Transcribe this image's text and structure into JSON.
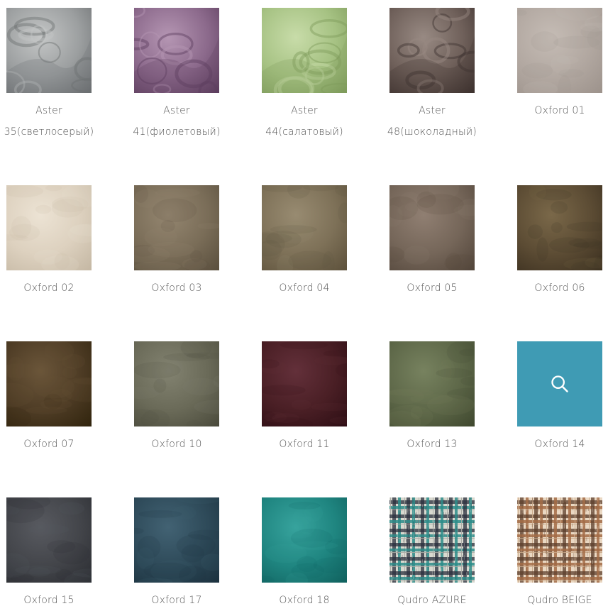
{
  "swatches": [
    {
      "id": "aster-35",
      "lines": [
        "Aster",
        "35(светлосерый)"
      ],
      "color": "#9c9fa0",
      "light": "#c4c6c6",
      "dark": "#6d7072",
      "pattern": "damask"
    },
    {
      "id": "aster-41",
      "lines": [
        "Aster",
        "41(фиолетовый)"
      ],
      "color": "#8c6a8c",
      "light": "#b596b3",
      "dark": "#5e3f5f",
      "pattern": "damask"
    },
    {
      "id": "aster-44",
      "lines": [
        "Aster",
        "44(салатовый)"
      ],
      "color": "#a6c283",
      "light": "#c8dca9",
      "dark": "#7f9c5c",
      "pattern": "damask"
    },
    {
      "id": "aster-48",
      "lines": [
        "Aster",
        "48(шоколадный)"
      ],
      "color": "#6f605a",
      "light": "#988a83",
      "dark": "#3f3330",
      "pattern": "damask"
    },
    {
      "id": "oxford-01",
      "lines": [
        "Oxford 01"
      ],
      "color": "#b2a8a1",
      "light": "#c5bcb5",
      "dark": "#9e948d",
      "pattern": "velvet"
    },
    {
      "id": "oxford-02",
      "lines": [
        "Oxford 02"
      ],
      "color": "#ddd1bf",
      "light": "#ece3d4",
      "dark": "#c6b9a5",
      "pattern": "velvet"
    },
    {
      "id": "oxford-03",
      "lines": [
        "Oxford 03"
      ],
      "color": "#7a6d58",
      "light": "#948670",
      "dark": "#5c513f",
      "pattern": "velvet"
    },
    {
      "id": "oxford-04",
      "lines": [
        "Oxford 04"
      ],
      "color": "#7e7158",
      "light": "#988b71",
      "dark": "#5f533d",
      "pattern": "velvet"
    },
    {
      "id": "oxford-05",
      "lines": [
        "Oxford 05"
      ],
      "color": "#756659",
      "light": "#907f72",
      "dark": "#54473c",
      "pattern": "velvet"
    },
    {
      "id": "oxford-06",
      "lines": [
        "Oxford 06"
      ],
      "color": "#5c4c34",
      "light": "#7a6849",
      "dark": "#3c3020",
      "pattern": "velvet"
    },
    {
      "id": "oxford-07",
      "lines": [
        "Oxford 07"
      ],
      "color": "#4e3c25",
      "light": "#6b563a",
      "dark": "#33260f",
      "pattern": "velvet"
    },
    {
      "id": "oxford-10",
      "lines": [
        "Oxford 10"
      ],
      "color": "#6a6a58",
      "light": "#838371",
      "dark": "#4c4c3d",
      "pattern": "velvet"
    },
    {
      "id": "oxford-11",
      "lines": [
        "Oxford 11"
      ],
      "color": "#4a1f25",
      "light": "#63303a",
      "dark": "#2f0f15",
      "pattern": "velvet"
    },
    {
      "id": "oxford-13",
      "lines": [
        "Oxford 13"
      ],
      "color": "#5d6748",
      "light": "#77825f",
      "dark": "#414a30",
      "pattern": "velvet"
    },
    {
      "id": "oxford-14",
      "lines": [
        "Oxford 14"
      ],
      "color": "#3f9bb4",
      "light": "#4ea8c0",
      "dark": "#3790a8",
      "pattern": "hover",
      "overlay_icon": "search-icon"
    },
    {
      "id": "oxford-15",
      "lines": [
        "Oxford 15"
      ],
      "color": "#43454a",
      "light": "#585a60",
      "dark": "#2c2e33",
      "pattern": "velvet"
    },
    {
      "id": "oxford-17",
      "lines": [
        "Oxford 17"
      ],
      "color": "#2e4a59",
      "light": "#426273",
      "dark": "#1d3340",
      "pattern": "velvet"
    },
    {
      "id": "oxford-18",
      "lines": [
        "Oxford 18"
      ],
      "color": "#1f8580",
      "light": "#37a39d",
      "dark": "#116360",
      "pattern": "velvet"
    },
    {
      "id": "qudro-azure",
      "lines": [
        "Qudro AZURE"
      ],
      "color": "#a9aaa4",
      "light": "#d9d9d0",
      "dark": "#2a2f3d",
      "accent": "#2d8c8a",
      "pattern": "plaid"
    },
    {
      "id": "qudro-beige",
      "lines": [
        "Qudro BEIGE"
      ],
      "color": "#c8a88a",
      "light": "#ead8c3",
      "dark": "#5c3f2c",
      "accent": "#a36c46",
      "pattern": "plaid"
    }
  ]
}
